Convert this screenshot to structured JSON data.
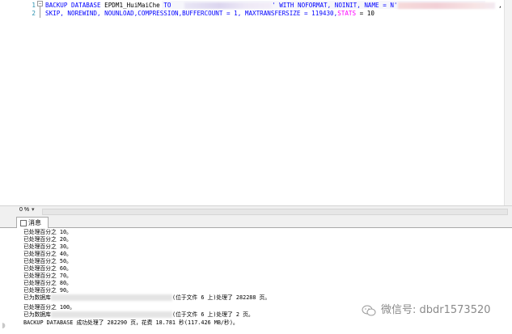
{
  "editor": {
    "line_numbers": [
      "1",
      "2"
    ],
    "line1_a": "BACKUP DATABASE",
    "line1_b": "EPDM1_HuiMaiChe",
    "line1_c": "TO",
    "line1_d": "' WITH NOFORMAT, NOINIT,  NAME = N'",
    "line1_e": ",",
    "line2_a": "SKIP, NOREWIND, NOUNLOAD,COMPRESSION,BUFFERCOUNT = 1, MAXTRANSFERSIZE = 119430,",
    "line2_b": "STATS",
    "line2_c": " = 10"
  },
  "zoom": {
    "value": "0 %",
    "arrow": "▾"
  },
  "tabs": {
    "messages_label": "消息"
  },
  "messages": [
    "已处理百分之 10。",
    "已处理百分之 20。",
    "已处理百分之 30。",
    "已处理百分之 40。",
    "已处理百分之 50。",
    "已处理百分之 60。",
    "已处理百分之 70。",
    "已处理百分之 80。",
    "已处理百分之 90。"
  ],
  "db_msg_1_prefix": "已为数据库",
  "db_msg_1_suffix": "(位于文件 6 上)处理了 282288 页。",
  "msg_100": "已处理百分之 100。",
  "db_msg_2_prefix": "已为数据库",
  "db_msg_2_suffix": "(位于文件 6 上)处理了 2 页。",
  "summary": "BACKUP DATABASE 成功处理了 282290 页，花费 18.781 秒(117.426 MB/秒)。",
  "watermark": {
    "text": "微信号: dbdr1573520"
  },
  "colors": {
    "keyword": "#0000ff",
    "string": "#ff0000",
    "line_number": "#2b91af"
  }
}
